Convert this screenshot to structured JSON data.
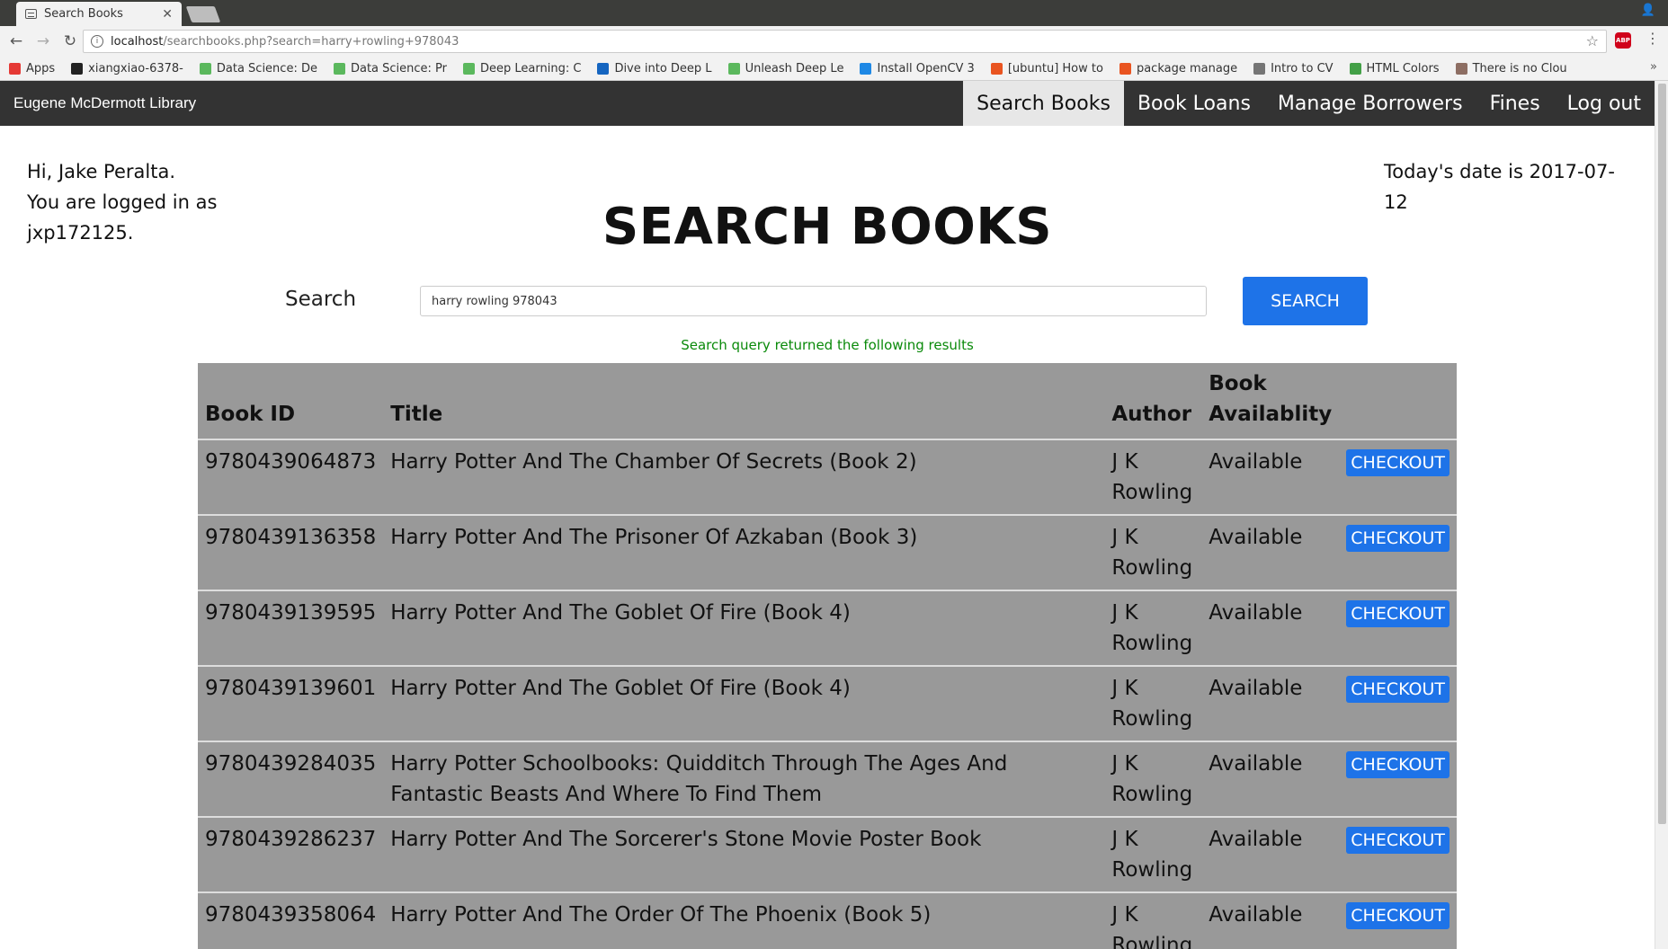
{
  "browser": {
    "tab_title": "Search Books",
    "url_host": "localhost",
    "url_path": "/searchbooks.php?search=harry+rowling+978043",
    "bookmarks": [
      {
        "label": "Apps",
        "icon": "apps-grid-icon",
        "color": "#e53935"
      },
      {
        "label": "xiangxiao-6378-",
        "icon": "github-icon",
        "color": "#222222"
      },
      {
        "label": "Data Science: De",
        "icon": "udacity-icon",
        "color": "#5bb85d"
      },
      {
        "label": "Data Science: Pr",
        "icon": "udacity-icon",
        "color": "#5bb85d"
      },
      {
        "label": "Deep Learning: C",
        "icon": "udacity-icon",
        "color": "#5bb85d"
      },
      {
        "label": "Dive into Deep L",
        "icon": "page-icon",
        "color": "#1565c0"
      },
      {
        "label": "Unleash Deep Le",
        "icon": "udacity-icon",
        "color": "#5bb85d"
      },
      {
        "label": "Install OpenCV 3",
        "icon": "pyimagesearch-icon",
        "color": "#1e88e5"
      },
      {
        "label": "[ubuntu] How to",
        "icon": "ubuntu-icon",
        "color": "#e95420"
      },
      {
        "label": "package manage",
        "icon": "askubuntu-icon",
        "color": "#e95420"
      },
      {
        "label": "Intro to CV",
        "icon": "folder-icon",
        "color": "#757575"
      },
      {
        "label": "HTML Colors",
        "icon": "colors-icon",
        "color": "#43a047"
      },
      {
        "label": "There is no Clou",
        "icon": "sticker-icon",
        "color": "#8d6e63"
      }
    ]
  },
  "nav": {
    "brand": "Eugene McDermott Library",
    "links": [
      "Search Books",
      "Book Loans",
      "Manage Borrowers",
      "Fines",
      "Log out"
    ]
  },
  "greeting": {
    "line1": "Hi, Jake Peralta.",
    "line2": "You are logged in as jxp172125."
  },
  "date_text": "Today's date is 2017-07-12",
  "page_title": "SEARCH BOOKS",
  "search": {
    "label": "Search",
    "value": "harry rowling 978043",
    "button": "SEARCH"
  },
  "status_message": "Search query returned the following results",
  "table": {
    "headers": [
      "Book ID",
      "Title",
      "Author",
      "Book Availablity"
    ],
    "checkout_label": "CHECKOUT",
    "rows": [
      {
        "id": "9780439064873",
        "title": "Harry Potter And The Chamber Of Secrets (Book 2)",
        "author": "J K Rowling",
        "availability": "Available"
      },
      {
        "id": "9780439136358",
        "title": "Harry Potter And The Prisoner Of Azkaban (Book 3)",
        "author": "J K Rowling",
        "availability": "Available"
      },
      {
        "id": "9780439139595",
        "title": "Harry Potter And The Goblet Of Fire (Book 4)",
        "author": "J K Rowling",
        "availability": "Available"
      },
      {
        "id": "9780439139601",
        "title": "Harry Potter And The Goblet Of Fire (Book 4)",
        "author": "J K Rowling",
        "availability": "Available"
      },
      {
        "id": "9780439284035",
        "title": "Harry Potter Schoolbooks: Quidditch Through The Ages And Fantastic Beasts And Where To Find Them",
        "author": "J K Rowling",
        "availability": "Available"
      },
      {
        "id": "9780439286237",
        "title": "Harry Potter And The Sorcerer's Stone Movie Poster Book",
        "author": "J K Rowling",
        "availability": "Available"
      },
      {
        "id": "9780439358064",
        "title": "Harry Potter And The Order Of The Phoenix (Book 5)",
        "author": "J K Rowling",
        "availability": "Available"
      }
    ]
  }
}
